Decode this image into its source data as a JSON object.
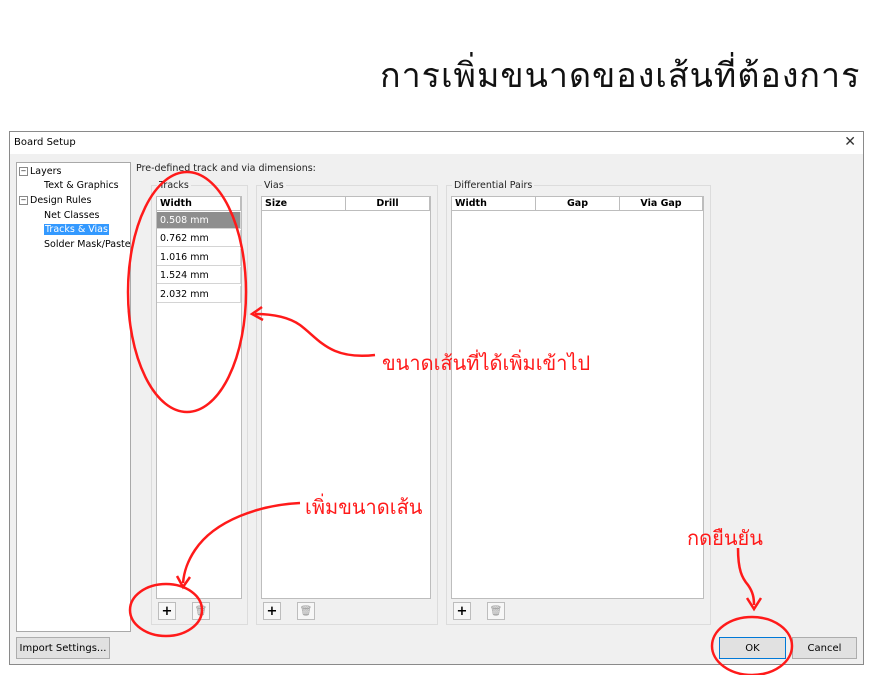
{
  "slide": {
    "title": "การเพิ่มขนาดของเส้นที่ต้องการ",
    "annotation_added": "ขนาดเส้นที่ได้เพิ่มเข้าไป",
    "annotation_add": "เพิ่มขนาดเส้น",
    "annotation_confirm": "กดยืนยัน",
    "annotation_color": "#ff1a1a"
  },
  "dialog": {
    "title": "Board Setup",
    "close_symbol": "✕",
    "tree": {
      "layers": "Layers",
      "text_graphics": "Text & Graphics",
      "design_rules": "Design Rules",
      "net_classes": "Net Classes",
      "tracks_vias": "Tracks & Vias",
      "solder_mask": "Solder Mask/Paste",
      "expander_symbol": "−"
    },
    "heading": "Pre-defined track and via dimensions:",
    "tracks": {
      "label": "Tracks",
      "column": "Width",
      "rows": [
        "0.508 mm",
        "0.762 mm",
        "1.016 mm",
        "1.524 mm",
        "2.032 mm"
      ],
      "selected_row": 0
    },
    "vias": {
      "label": "Vias",
      "columns": [
        "Size",
        "Drill"
      ]
    },
    "diff_pairs": {
      "label": "Differential Pairs",
      "columns": [
        "Width",
        "Gap",
        "Via Gap"
      ]
    },
    "add_symbol": "+",
    "delete_icon": "trash-icon",
    "import_button": "Import Settings...",
    "ok_button": "OK",
    "cancel_button": "Cancel"
  }
}
